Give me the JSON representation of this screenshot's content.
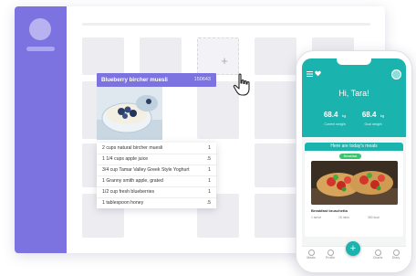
{
  "board": {
    "add_symbol": "+"
  },
  "recipe_card": {
    "title": "Blueberry bircher muesli",
    "kcal": "150643",
    "ingredients": [
      {
        "name": "2 cups natural bircher muesli",
        "qty": "1"
      },
      {
        "name": "1 1/4 cups apple juice",
        "qty": ".5"
      },
      {
        "name": "3/4 cup Tamar Valley Greek Style Yoghurt",
        "qty": "1"
      },
      {
        "name": "1 Granny smith apple, grated",
        "qty": "1"
      },
      {
        "name": "1/2 cup fresh blueberries",
        "qty": "1"
      },
      {
        "name": "1 tablespoon honey",
        "qty": ".5"
      }
    ]
  },
  "phone": {
    "greeting": "Hi, Tara!",
    "stats": [
      {
        "value": "68.4",
        "unit": "kg",
        "label": "Current weight"
      },
      {
        "value": "68.4",
        "unit": "kg",
        "label": "Goal weight"
      }
    ],
    "meals_heading": "Here are today's meals",
    "meal_tag": "Breakfast",
    "meal_title": "Breakfast bruschetta",
    "meal_meta": [
      "1 serve",
      "15 mins",
      "350 kcal"
    ],
    "nav": [
      {
        "label": "Meals"
      },
      {
        "label": "Profile"
      },
      {
        "label": "Charts"
      },
      {
        "label": "Diary"
      }
    ],
    "fab_symbol": "+"
  },
  "colors": {
    "accent_purple": "#7d73e0",
    "accent_teal": "#1bb3ad",
    "tag_green": "#39c36a"
  }
}
